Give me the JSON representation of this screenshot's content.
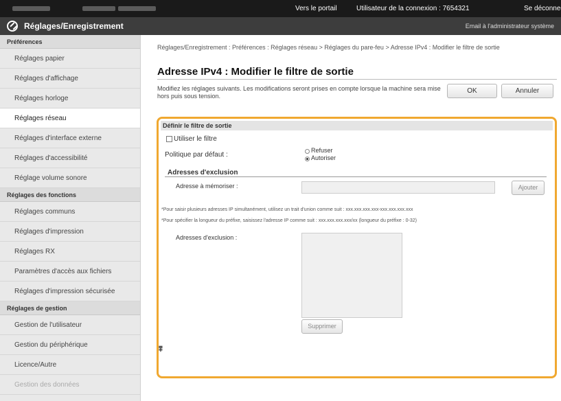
{
  "topbar": {
    "portal_link": "Vers le portail",
    "user_info": "Utilisateur de la connexion : 7654321",
    "logout_label": "Se déconnecter"
  },
  "header": {
    "title": "Réglages/Enregistrement",
    "admin_email_link": "Email à l'administrateur système"
  },
  "sidebar": {
    "sections": [
      {
        "heading": "Préférences",
        "items": [
          "Réglages papier",
          "Réglages d'affichage",
          "Réglages horloge",
          "Réglages réseau",
          "Réglages d'interface externe",
          "Réglages d'accessibilité",
          "Réglage volume sonore"
        ]
      },
      {
        "heading": "Réglages des fonctions",
        "items": [
          "Réglages communs",
          "Réglages d'impression",
          "Réglages RX",
          "Paramètres d'accès aux fichiers",
          "Réglages d'impression sécurisée"
        ]
      },
      {
        "heading": "Réglages de gestion",
        "items": [
          "Gestion de l'utilisateur",
          "Gestion du périphérique",
          "Licence/Autre",
          "Gestion des données"
        ]
      }
    ],
    "active_item": "Réglages réseau"
  },
  "main": {
    "breadcrumb": "Réglages/Enregistrement : Préférences : Réglages réseau > Réglages du pare-feu > Adresse IPv4 : Modifier le filtre de sortie",
    "title": "Adresse IPv4 : Modifier le filtre de sortie",
    "description": "Modifiez les réglages suivants. Les modifications seront prises en compte lorsque la machine sera mise hors puis sous tension.",
    "ok_label": "OK",
    "cancel_label": "Annuler",
    "panel": {
      "heading": "Définir le filtre de sortie",
      "use_filter_label": "Utiliser le filtre",
      "use_filter_checked": false,
      "policy_label": "Politique par défaut :",
      "policy_options": [
        "Refuser",
        "Autoriser"
      ],
      "policy_selected": "Autoriser",
      "exclusion_heading": "Adresses d'exclusion",
      "address_to_store_label": "Adresse à mémoriser :",
      "address_input_value": "",
      "add_label": "Ajouter",
      "note_range": "*Pour saisir plusieurs adresses IP simultanément, utilisez un trait d'union comme suit : xxx.xxx.xxx.xxx-xxx.xxx.xxx.xxx",
      "note_prefix": "*Pour spécifier la longueur du préfixe, saisissez l'adresse IP comme suit : xxx.xxx.xxx.xxx/xx (longueur du préfixe : 0-32)",
      "exclusion_list_label": "Adresses d'exclusion :",
      "exclusion_list": [],
      "delete_label": "Supprimer"
    },
    "back_to_top_glyph": "⩱"
  }
}
